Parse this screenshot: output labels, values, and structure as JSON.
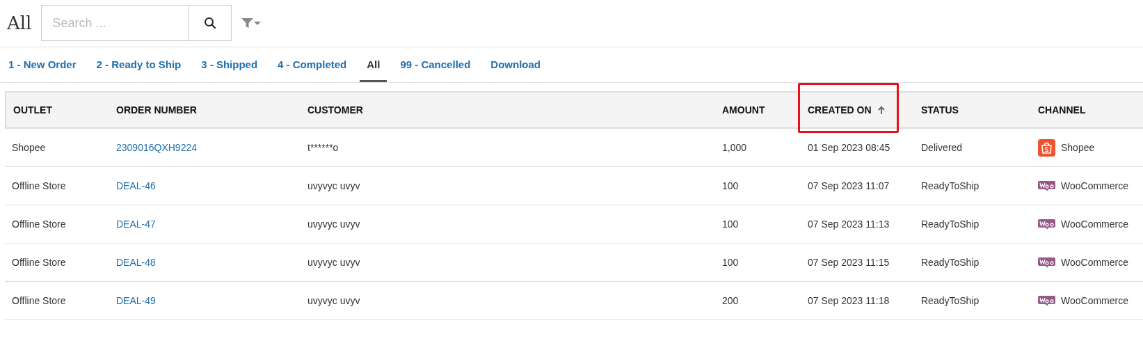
{
  "page_title": "All",
  "search": {
    "placeholder": "Search ..."
  },
  "tabs": [
    {
      "label": "1 - New Order",
      "selected": false
    },
    {
      "label": "2 - Ready to Ship",
      "selected": false
    },
    {
      "label": "3 - Shipped",
      "selected": false
    },
    {
      "label": "4 - Completed",
      "selected": false
    },
    {
      "label": "All",
      "selected": true
    },
    {
      "label": "99 - Cancelled",
      "selected": false
    },
    {
      "label": "Download",
      "selected": false
    }
  ],
  "table": {
    "columns": [
      {
        "label": "OUTLET",
        "sorted": false,
        "highlighted": false
      },
      {
        "label": "ORDER NUMBER",
        "sorted": false,
        "highlighted": false
      },
      {
        "label": "CUSTOMER",
        "sorted": false,
        "highlighted": false
      },
      {
        "label": "AMOUNT",
        "sorted": false,
        "highlighted": false
      },
      {
        "label": "CREATED ON",
        "sorted": true,
        "highlighted": true
      },
      {
        "label": "STATUS",
        "sorted": false,
        "highlighted": false
      },
      {
        "label": "CHANNEL",
        "sorted": false,
        "highlighted": false
      }
    ],
    "rows": [
      {
        "outlet": "Shopee",
        "order_number": "2309016QXH9224",
        "customer": "t******o",
        "amount": "1,000",
        "created_on": "01 Sep 2023 08:45",
        "status": "Delivered",
        "channel": {
          "kind": "shopee",
          "label": "Shopee"
        }
      },
      {
        "outlet": "Offline Store",
        "order_number": "DEAL-46",
        "customer": "uvyvyc uvyv",
        "amount": "100",
        "created_on": "07 Sep 2023 11:07",
        "status": "ReadyToShip",
        "channel": {
          "kind": "woocommerce",
          "label": "WooCommerce"
        }
      },
      {
        "outlet": "Offline Store",
        "order_number": "DEAL-47",
        "customer": "uvyvyc uvyv",
        "amount": "100",
        "created_on": "07 Sep 2023 11:13",
        "status": "ReadyToShip",
        "channel": {
          "kind": "woocommerce",
          "label": "WooCommerce"
        }
      },
      {
        "outlet": "Offline Store",
        "order_number": "DEAL-48",
        "customer": "uvyvyc uvyv",
        "amount": "100",
        "created_on": "07 Sep 2023 11:15",
        "status": "ReadyToShip",
        "channel": {
          "kind": "woocommerce",
          "label": "WooCommerce"
        }
      },
      {
        "outlet": "Offline Store",
        "order_number": "DEAL-49",
        "customer": "uvyvyc uvyv",
        "amount": "200",
        "created_on": "07 Sep 2023 11:18",
        "status": "ReadyToShip",
        "channel": {
          "kind": "woocommerce",
          "label": "WooCommerce"
        }
      }
    ]
  }
}
